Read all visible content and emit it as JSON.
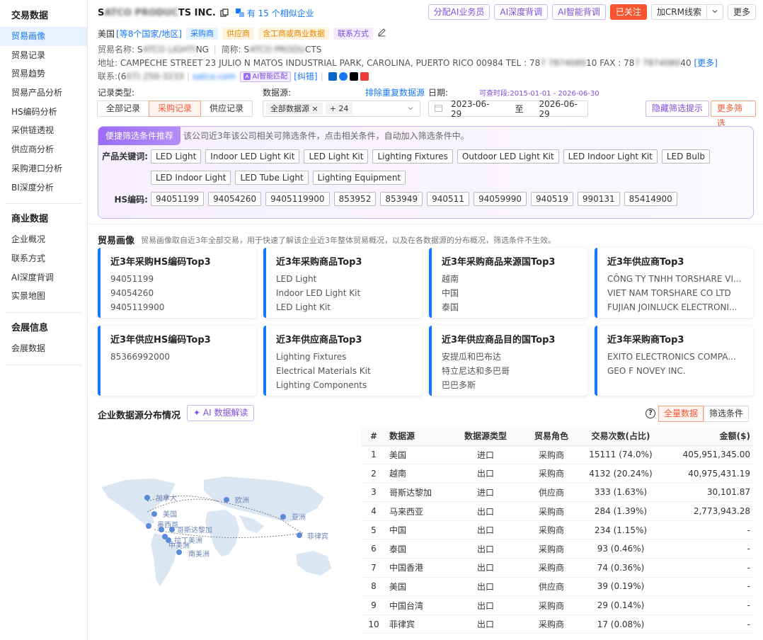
{
  "sidebar": {
    "groups": [
      {
        "title": "交易数据",
        "items": [
          "贸易画像",
          "贸易记录",
          "贸易趋势",
          "贸易产品分析",
          "HS编码分析",
          "采供链透视",
          "供应商分析",
          "采购港口分析",
          "BI深度分析"
        ]
      },
      {
        "title": "商业数据",
        "items": [
          "企业概况",
          "联系方式",
          "AI深度背调",
          "实景地图"
        ]
      },
      {
        "title": "会展信息",
        "items": [
          "会展数据"
        ]
      }
    ]
  },
  "header": {
    "company_visible": "S",
    "company_blur": "ATCO PRODUC",
    "company_tail": "TS INC.",
    "similar_text": "有 15 个相似企业",
    "buttons": {
      "assign": "分配AI业务员",
      "deep": "AI深度背调",
      "smart": "AI智能背调",
      "followed": "已关注",
      "crm": "加CRM线索",
      "more": "更多"
    },
    "country": "美国",
    "country_more": "[等8个国家/地区]",
    "tags": [
      "采购商",
      "供应商",
      "含工商或商业数据",
      "联系方式"
    ],
    "trade_name_label": "贸易名称:",
    "trade_name_a": "S",
    "trade_name_blur": "ATCO LIGHTI",
    "trade_name_b": "NG",
    "short_label": "简称:",
    "short_a": "S",
    "short_blur": "ATCO PRODU",
    "short_b": "CTS",
    "address_label": "地址:",
    "address": "CAMPECHE STREET 23 JULIO N MATOS INDUSTRIAL PARK, CAROLINA, PUERTO RICO 00984 TEL : 78",
    "address_blur1": "7 7874080",
    "address_mid": "10 FAX : 78",
    "address_blur2": "7 7874080",
    "address_end": "40",
    "address_more": "[更多]",
    "contact_label": "联系:",
    "contact_a": "(6",
    "contact_blur": "07) 250-3233",
    "contact_email_blur": "satco.com",
    "ai_match": "AI智能匹配",
    "correct": "[纠错]"
  },
  "filters": {
    "record_type_label": "记录类型:",
    "record_types": [
      "全部记录",
      "采购记录",
      "供应记录"
    ],
    "datasource_label": "数据源:",
    "exclude_dup": "排除重复数据源",
    "datasource_chip": "全部数据源",
    "datasource_more": "+ 24",
    "date_label": "日期:",
    "date_hint": "可查时段:2015-01-01 - 2026-06-30",
    "date_from": "2023-06-29",
    "date_to_label": "至",
    "date_to": "2026-06-29",
    "hide_tips": "隐藏筛选提示",
    "more_filters": "更多筛选"
  },
  "quick": {
    "title": "便捷筛选条件推荐",
    "desc": "该公司近3年该公司相关可筛选条件，点击相关条件，自动加入筛选条件中。",
    "kw_label": "产品关键词:",
    "keywords": [
      "LED Light",
      "Indoor LED Light Kit",
      "LED Light Kit",
      "Lighting Fixtures",
      "Outdoor LED Light Kit",
      "LED Indoor Light Kit",
      "LED Bulb",
      "LED Indoor Light",
      "LED Tube Light",
      "Lighting Equipment"
    ],
    "hs_label": "HS编码:",
    "hs_codes": [
      "94051199",
      "94054260",
      "9405119900",
      "853952",
      "853949",
      "940511",
      "94059990",
      "940519",
      "990131",
      "85414900"
    ]
  },
  "portrait": {
    "title": "贸易画像",
    "desc": "贸易画像取自近3年全部交易，用于快速了解该企业近3年整体贸易概况，以及在各数据源的分布概况，筛选条件不生效。",
    "cards": [
      {
        "title": "近3年采购HS编码Top3",
        "items": [
          "94051199",
          "94054260",
          "9405119900"
        ]
      },
      {
        "title": "近3年采购商品Top3",
        "items": [
          "LED Light",
          "Indoor LED Light Kit",
          "LED Light Kit"
        ]
      },
      {
        "title": "近3年采购商品来源国Top3",
        "items": [
          "越南",
          "中国",
          "泰国"
        ]
      },
      {
        "title": "近3年供应商Top3",
        "items": [
          "CÔNG TY TNHH TORSHARE VI...",
          "VIET NAM TORSHARE CO LTD",
          "FUJIAN JOINLUCK ELECTRONI..."
        ]
      },
      {
        "title": "近3年供应HS编码Top3",
        "items": [
          "85366992000"
        ]
      },
      {
        "title": "近3年供应商品Top3",
        "items": [
          "Lighting Fixtures",
          "Electrical Materials Kit",
          "Lighting Components"
        ]
      },
      {
        "title": "近3年供应商品目的国Top3",
        "items": [
          "安提瓜和巴布达",
          "特立尼达和多巴哥",
          "巴巴多斯"
        ]
      },
      {
        "title": "近3年采购商Top3",
        "items": [
          "EXITO ELECTRONICS COMPA...",
          "GEO F NOVEY INC."
        ]
      }
    ]
  },
  "distribution": {
    "title": "企业数据源分布情况",
    "ai_btn": "AI 数据解读",
    "toggle": [
      "全量数据",
      "筛选条件"
    ],
    "map_labels": [
      "加拿大",
      "欧洲",
      "美国",
      "亚洲",
      "菲律宾",
      "墨西哥",
      "南美洲",
      "拉丁美洲",
      "哥斯达黎加",
      "中美洲"
    ],
    "columns": [
      "#",
      "数据源",
      "数据源类型",
      "贸易角色",
      "交易次数(占比)",
      "金额($)"
    ],
    "rows": [
      [
        "1",
        "美国",
        "进口",
        "采购商",
        "15111 (74.0%)",
        "405,951,345.00"
      ],
      [
        "2",
        "越南",
        "出口",
        "采购商",
        "4132 (20.24%)",
        "40,975,431.19"
      ],
      [
        "3",
        "哥斯达黎加",
        "进口",
        "供应商",
        "333 (1.63%)",
        "30,101.87"
      ],
      [
        "4",
        "马来西亚",
        "出口",
        "采购商",
        "284 (1.39%)",
        "2,773,943.28"
      ],
      [
        "5",
        "中国",
        "出口",
        "采购商",
        "234 (1.15%)",
        "-"
      ],
      [
        "6",
        "泰国",
        "出口",
        "采购商",
        "93 (0.46%)",
        "-"
      ],
      [
        "7",
        "中国香港",
        "出口",
        "采购商",
        "74 (0.36%)",
        "-"
      ],
      [
        "8",
        "美国",
        "出口",
        "供应商",
        "39 (0.19%)",
        "-"
      ],
      [
        "9",
        "中国台湾",
        "出口",
        "采购商",
        "29 (0.14%)",
        "-"
      ],
      [
        "10",
        "菲律宾",
        "出口",
        "采购商",
        "17 (0.08%)",
        "-"
      ]
    ]
  }
}
